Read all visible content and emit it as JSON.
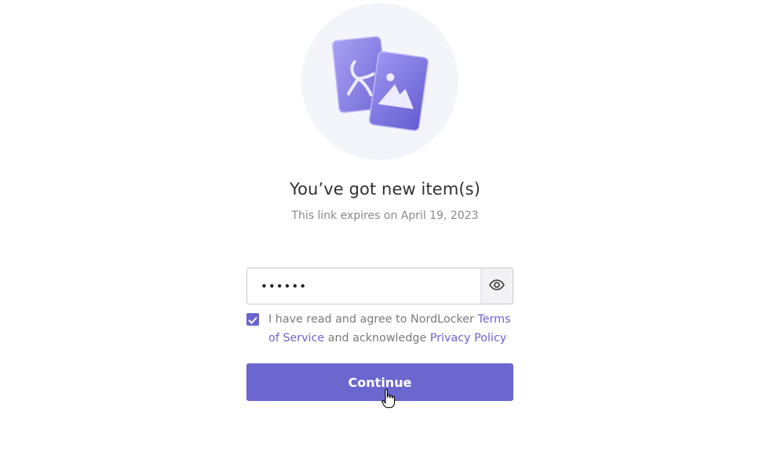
{
  "header": {
    "title": "You’ve got new item(s)",
    "subtitle": "This link expires on April 19, 2023"
  },
  "password": {
    "value": "••••••",
    "toggle_icon": "eye-icon"
  },
  "agreement": {
    "checked": true,
    "text_before": "I have read and agree to NordLocker ",
    "terms_link": "Terms of Service",
    "text_middle": " and acknowledge ",
    "privacy_link": "Privacy Policy"
  },
  "actions": {
    "continue_label": "Continue"
  },
  "colors": {
    "accent": "#6c66cf",
    "hero_background": "#f4f5fb"
  },
  "icons": {
    "hero": "shared-files-illustration",
    "checkbox": "checkmark-icon",
    "cursor": "hand-pointer-icon"
  }
}
